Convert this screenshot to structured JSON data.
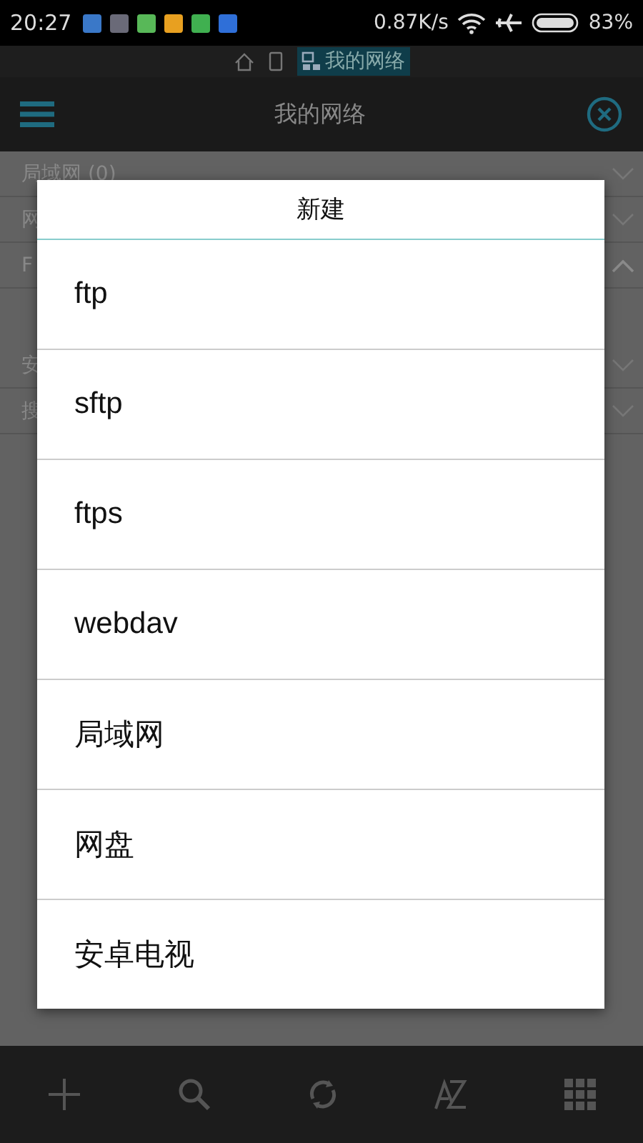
{
  "status_bar": {
    "time": "20:27",
    "notifications": [
      {
        "color": "#3a78c8"
      },
      {
        "color": "#6a6a78"
      },
      {
        "color": "#58b858"
      },
      {
        "color": "#e8a020"
      },
      {
        "color": "#40b050"
      },
      {
        "color": "#2f6fd8"
      }
    ],
    "speed": "0.87K/s",
    "battery": "83%"
  },
  "breadcrumb": {
    "current": "我的网络"
  },
  "toolbar": {
    "title": "我的网络"
  },
  "list": [
    {
      "label": "局域网 (0)",
      "expanded": false,
      "gap": false
    },
    {
      "label": "网",
      "expanded": false,
      "gap": false
    },
    {
      "label": "F",
      "expanded": true,
      "gap": false
    },
    {
      "label": "安",
      "expanded": false,
      "gap": true
    },
    {
      "label": "搜",
      "expanded": false,
      "gap": false
    }
  ],
  "dialog": {
    "title": "新建",
    "items": [
      "ftp",
      "sftp",
      "ftps",
      "webdav",
      "局域网",
      "网盘",
      "安卓电视"
    ]
  },
  "bottom_bar": [
    {
      "kind": "add"
    },
    {
      "kind": "search"
    },
    {
      "kind": "refresh"
    },
    {
      "kind": "sort"
    },
    {
      "kind": "grid"
    }
  ]
}
